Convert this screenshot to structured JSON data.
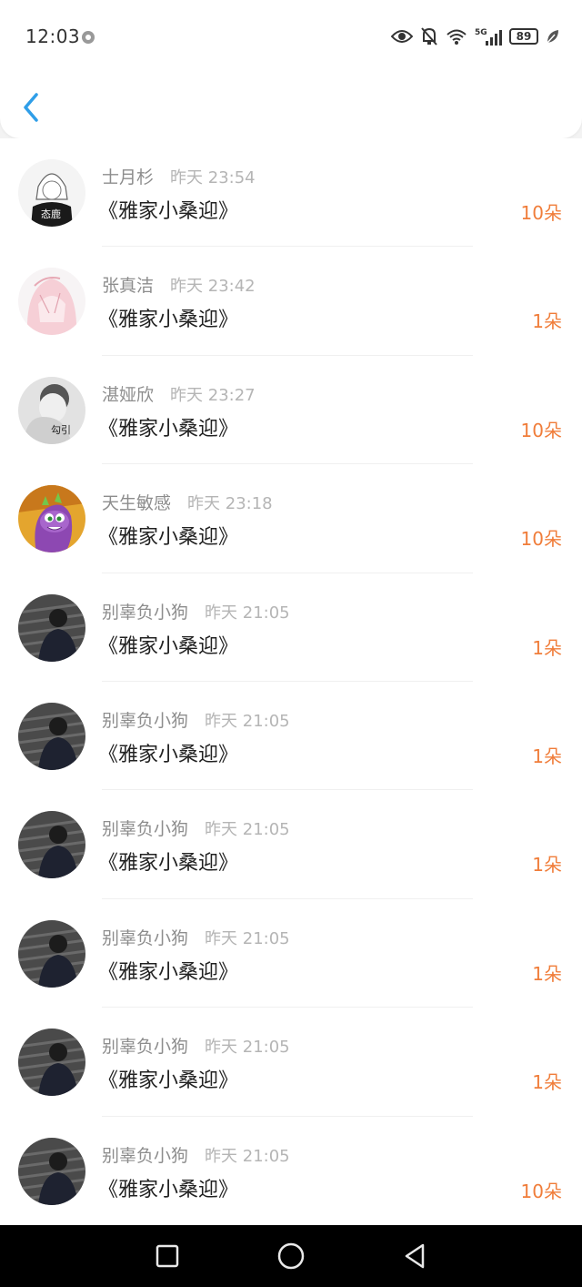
{
  "status_bar": {
    "time": "12:03",
    "network": "5G",
    "battery": "89",
    "icons": [
      "eye-icon",
      "mute-bell-icon",
      "wifi-icon",
      "signal-icon",
      "battery-icon",
      "leaf-icon"
    ]
  },
  "header": {
    "back_icon": "chevron-left-icon"
  },
  "colors": {
    "accent": "#f07d3a",
    "back_blue": "#2f9ee8"
  },
  "gifts": [
    {
      "name": "士月杉",
      "time": "昨天 23:54",
      "title": "《雅家小桑迎》",
      "count": "10朵",
      "avatar": "anime-girl-avatar"
    },
    {
      "name": "张真洁",
      "time": "昨天 23:42",
      "title": "《雅家小桑迎》",
      "count": "1朵",
      "avatar": "pink-anime-avatar"
    },
    {
      "name": "湛娅欣",
      "time": "昨天 23:27",
      "title": "《雅家小桑迎》",
      "count": "10朵",
      "avatar": "baby-avatar"
    },
    {
      "name": "天生敏感",
      "time": "昨天 23:18",
      "title": "《雅家小桑迎》",
      "count": "10朵",
      "avatar": "cartoon-dragon-avatar"
    },
    {
      "name": "别辜负小狗",
      "time": "昨天 21:05",
      "title": "《雅家小桑迎》",
      "count": "1朵",
      "avatar": "person-stairs-avatar"
    },
    {
      "name": "别辜负小狗",
      "time": "昨天 21:05",
      "title": "《雅家小桑迎》",
      "count": "1朵",
      "avatar": "person-stairs-avatar"
    },
    {
      "name": "别辜负小狗",
      "time": "昨天 21:05",
      "title": "《雅家小桑迎》",
      "count": "1朵",
      "avatar": "person-stairs-avatar"
    },
    {
      "name": "别辜负小狗",
      "time": "昨天 21:05",
      "title": "《雅家小桑迎》",
      "count": "1朵",
      "avatar": "person-stairs-avatar"
    },
    {
      "name": "别辜负小狗",
      "time": "昨天 21:05",
      "title": "《雅家小桑迎》",
      "count": "1朵",
      "avatar": "person-stairs-avatar"
    },
    {
      "name": "别辜负小狗",
      "time": "昨天 21:05",
      "title": "《雅家小桑迎》",
      "count": "10朵",
      "avatar": "person-stairs-avatar"
    }
  ],
  "avatar_labels": {
    "anime": "态鹿",
    "baby": "勾引"
  },
  "nav_bar": {
    "buttons": [
      "square-recents-icon",
      "circle-home-icon",
      "triangle-back-icon"
    ]
  }
}
